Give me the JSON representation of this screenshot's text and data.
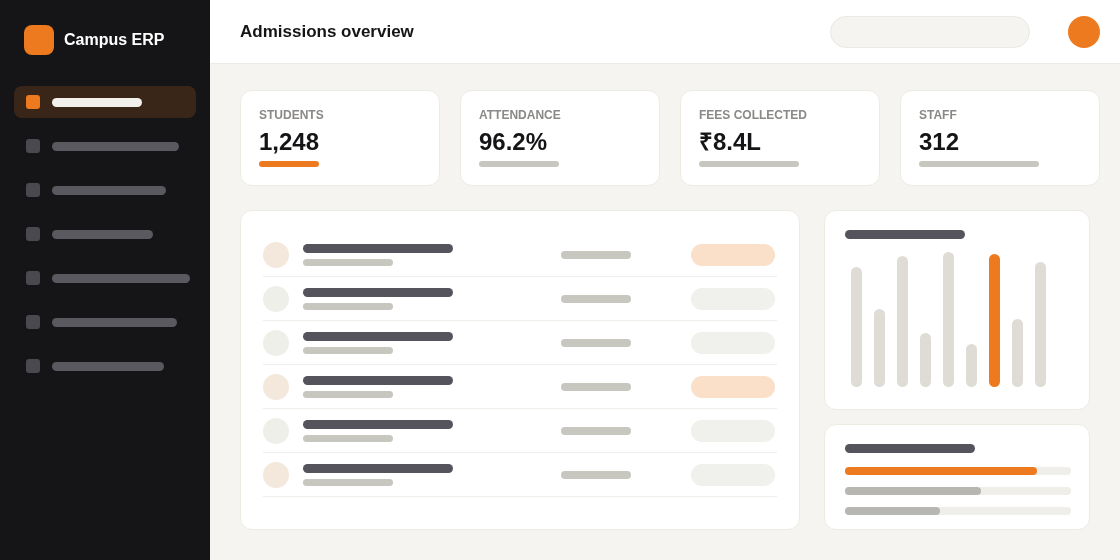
{
  "sidebar": {
    "app_name": "Campus ERP",
    "items": [
      {
        "selected": true
      },
      {
        "selected": false
      },
      {
        "selected": false
      },
      {
        "selected": false
      },
      {
        "selected": false
      },
      {
        "selected": false
      },
      {
        "selected": false
      }
    ]
  },
  "header": {
    "title": "Admissions overview"
  },
  "stats": [
    {
      "label": "STUDENTS",
      "value": "1,248",
      "selected": true
    },
    {
      "label": "ATTENDANCE",
      "value": "96.2%",
      "selected": false
    },
    {
      "label": "FEES COLLECTED",
      "value": "₹8.4L",
      "selected": false
    },
    {
      "label": "STAFF",
      "value": "312",
      "selected": false
    }
  ],
  "rows": [
    {
      "color": "#f4e8dd",
      "flagged": true
    },
    {
      "color": "#efefea",
      "flagged": false
    },
    {
      "color": "#efefea",
      "flagged": false
    },
    {
      "color": "#f4e8dd",
      "flagged": true
    },
    {
      "color": "#efefea",
      "flagged": false
    },
    {
      "color": "#f4e8dd",
      "flagged": false
    }
  ],
  "progress": [
    {
      "level": 0.85,
      "color": "#ee7a1f"
    },
    {
      "level": 0.6,
      "color": "#b7b6b0"
    },
    {
      "level": 0.42,
      "color": "#b7b6b0"
    }
  ]
}
